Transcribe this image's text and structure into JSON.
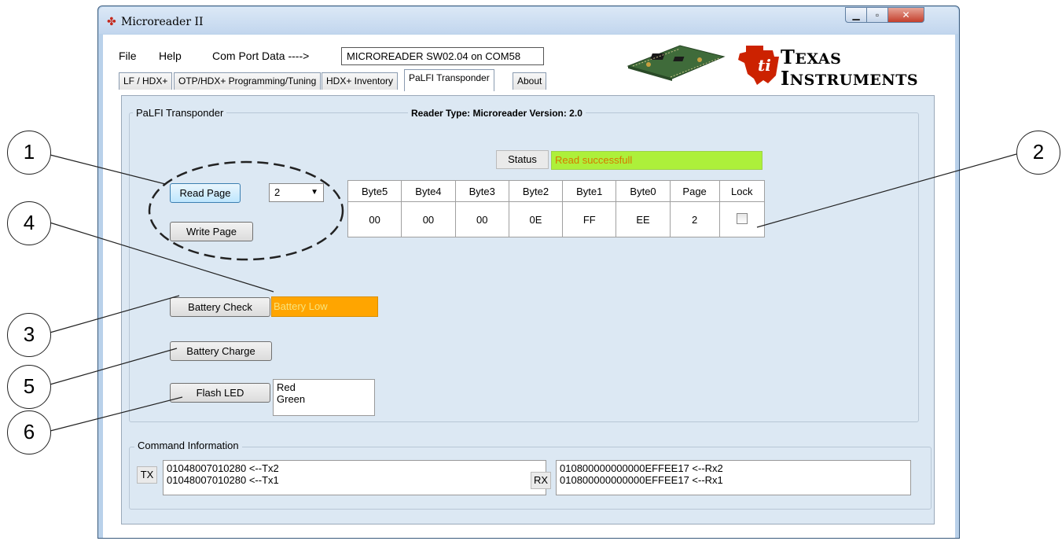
{
  "window": {
    "title": "Microreader II"
  },
  "menu": {
    "file": "File",
    "help": "Help",
    "com_port_label": "Com Port Data ---->",
    "com_port_value": "MICROREADER SW02.04 on COM58"
  },
  "tabs": [
    "LF / HDX+",
    "OTP/HDX+ Programming/Tuning",
    "HDX+ Inventory",
    "PaLFI Transponder",
    "About"
  ],
  "active_tab": "PaLFI Transponder",
  "logo": {
    "line1": "Texas",
    "line2": "Instruments",
    "accent": "#cc2200"
  },
  "palfi": {
    "group_title": "PaLFI Transponder",
    "reader_type": "Reader Type: Microreader   Version: 2.0",
    "status_label": "Status",
    "status_value": "Read successfull",
    "status_color": "#adf03a",
    "read_page": "Read Page",
    "page_select": "2",
    "write_page": "Write Page",
    "headers": [
      "Byte5",
      "Byte4",
      "Byte3",
      "Byte2",
      "Byte1",
      "Byte0",
      "Page",
      "Lock"
    ],
    "values": [
      "00",
      "00",
      "00",
      "0E",
      "FF",
      "EE",
      "2"
    ],
    "lock_checked": false,
    "battery_check": "Battery Check",
    "battery_status": "Battery Low",
    "battery_color": "#ffa500",
    "battery_charge": "Battery Charge",
    "flash_led": "Flash LED",
    "led_options": [
      "Red",
      "Green"
    ]
  },
  "command_info": {
    "title": "Command Information",
    "tx_label": "TX",
    "tx_lines": [
      "01048007010280  <--Tx2",
      "01048007010280  <--Tx1"
    ],
    "rx_label": "RX",
    "rx_lines": [
      "010800000000000EFFEE17 <--Rx2",
      "010800000000000EFFEE17 <--Rx1"
    ]
  },
  "annotations": [
    "1",
    "2",
    "3",
    "4",
    "5",
    "6"
  ]
}
